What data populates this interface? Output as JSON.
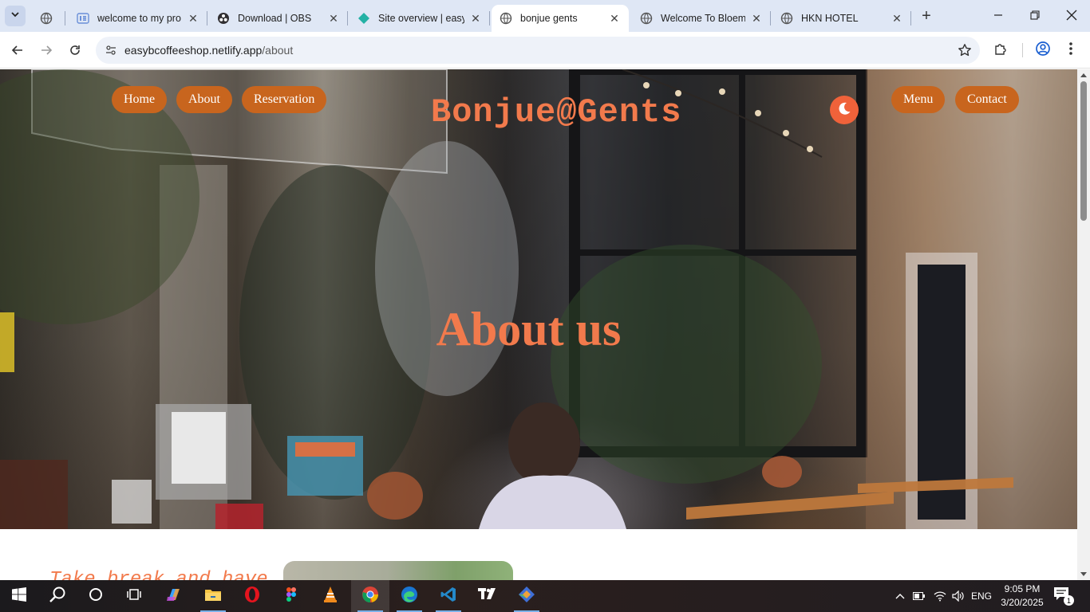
{
  "browser": {
    "tabs": [
      {
        "title": "welcome to my pro",
        "icon": "elementor-icon",
        "active": false
      },
      {
        "title": "Download | OBS",
        "icon": "obs-icon",
        "active": false
      },
      {
        "title": "Site overview | easyb",
        "icon": "netlify-icon",
        "active": false
      },
      {
        "title": "bonjue gents",
        "icon": "globe-icon",
        "active": true
      },
      {
        "title": "Welcome To Bloemb",
        "icon": "globe-icon",
        "active": false
      },
      {
        "title": "HKN HOTEL",
        "icon": "globe-icon",
        "active": false
      }
    ],
    "url_host": "easybcoffeeshop.netlify.app",
    "url_path": "/about"
  },
  "page": {
    "nav_left": [
      "Home",
      "About",
      "Reservation"
    ],
    "brand": "Bonjue@Gents",
    "nav_right": [
      "Menu",
      "Contact"
    ],
    "hero_title": "About us",
    "tagline": "Take break and have",
    "accent_color": "#f27a4c",
    "button_color": "#c8651e"
  },
  "taskbar": {
    "apps": [
      "start-icon",
      "search-icon",
      "cortana-icon",
      "task-view-icon",
      "copilot-icon",
      "file-explorer-icon",
      "opera-icon",
      "figma-icon",
      "vlc-icon",
      "chrome-icon",
      "edge-icon",
      "vscode-icon",
      "tradingview-icon",
      "git-icon"
    ],
    "language": "ENG",
    "time": "9:05 PM",
    "date": "3/20/2025",
    "notification_count": "1"
  }
}
